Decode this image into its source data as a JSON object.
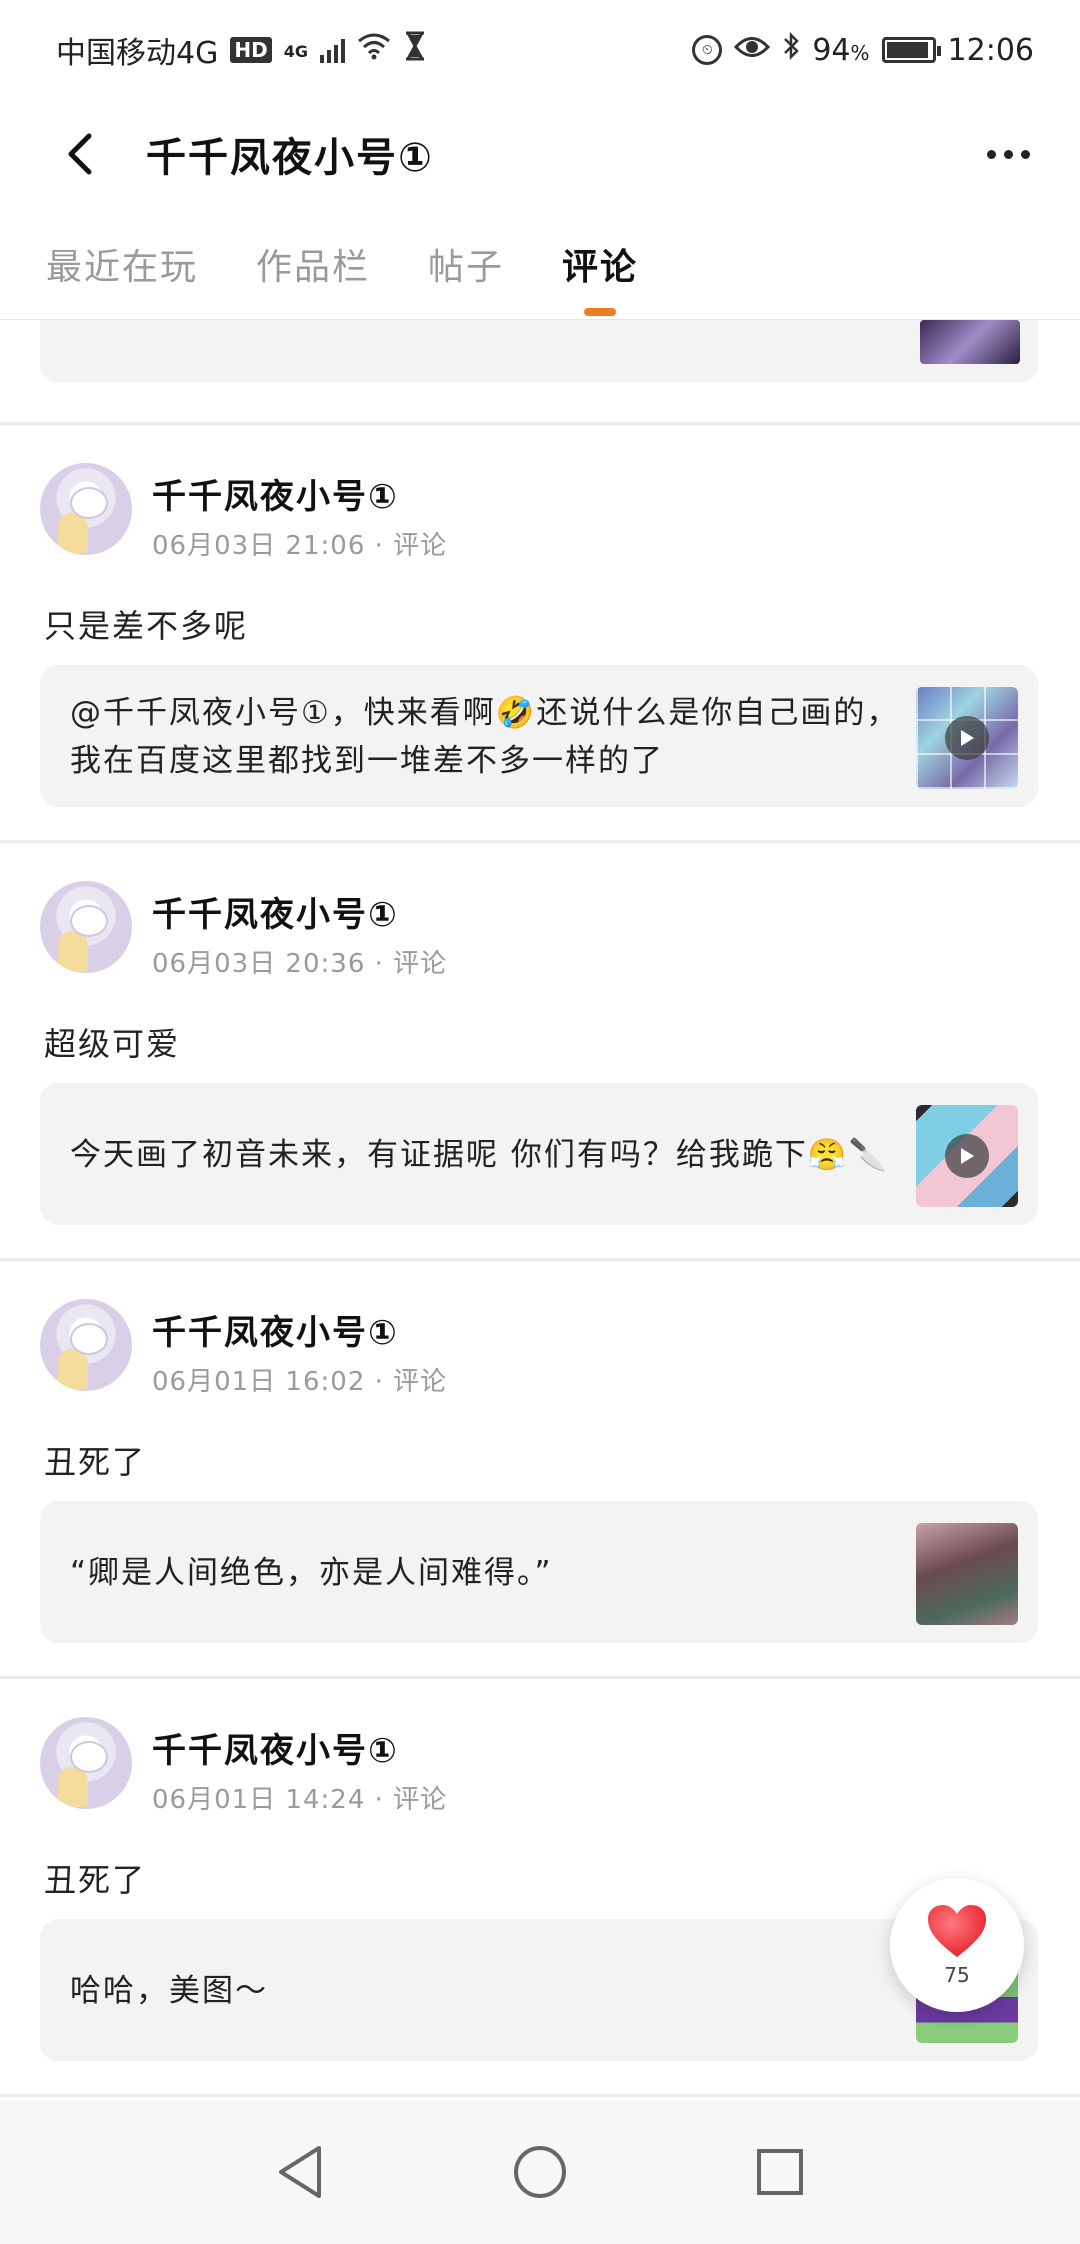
{
  "status_bar": {
    "carrier": "中国移动4G",
    "hd": "HD",
    "net": "4G",
    "battery": "94",
    "battery_unit": "%",
    "time": "12:06"
  },
  "header": {
    "title": "千千凤夜小号①"
  },
  "tabs": [
    {
      "label": "最近在玩",
      "active": false
    },
    {
      "label": "作品栏",
      "active": false
    },
    {
      "label": "帖子",
      "active": false
    },
    {
      "label": "评论",
      "active": true
    }
  ],
  "posts": [
    {
      "name": "千千凤夜小号①",
      "meta": "06月03日 21:06 · 评论",
      "text": "只是差不多呢",
      "quote": "@千千凤夜小号①，快来看啊🤣还说什么是你自己画的，我在百度这里都找到一堆差不多一样的了",
      "has_video": true
    },
    {
      "name": "千千凤夜小号①",
      "meta": "06月03日 20:36 · 评论",
      "text": "超级可爱",
      "quote": "今天画了初音未来，有证据呢  你们有吗？给我跪下😤🔪",
      "has_video": true
    },
    {
      "name": "千千凤夜小号①",
      "meta": "06月01日 16:02 · 评论",
      "text": "丑死了",
      "quote": "“卿是人间绝色，亦是人间难得。”",
      "has_video": false
    },
    {
      "name": "千千凤夜小号①",
      "meta": "06月01日 14:24 · 评论",
      "text": "丑死了",
      "quote": "哈哈，美图～",
      "has_video": false
    }
  ],
  "like_fab": {
    "count": "75"
  },
  "colors": {
    "accent": "#f07c22",
    "like": "#f2373f",
    "card_bg": "#f3f3f3"
  }
}
